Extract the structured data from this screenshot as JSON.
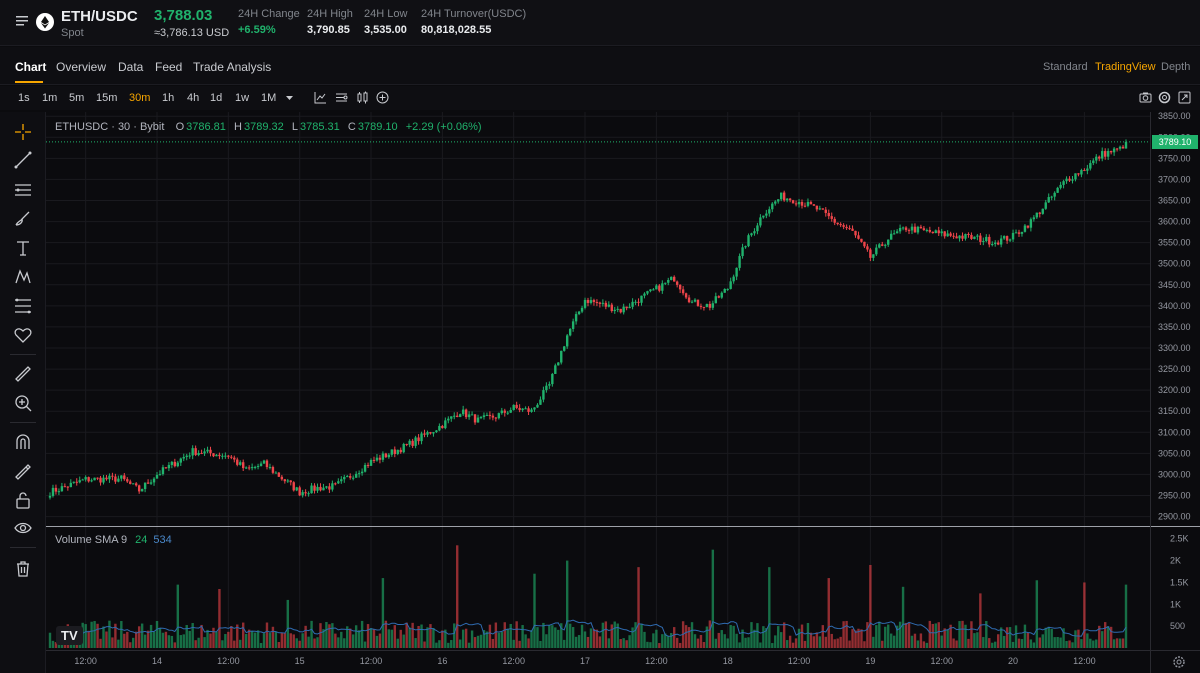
{
  "header": {
    "pair": "ETH/USDC",
    "market_type": "Spot",
    "last_price": "3,788.03",
    "last_price_usd": "≈3,786.13 USD",
    "stats": [
      {
        "label": "24H Change",
        "value": "+6.59%",
        "up": true
      },
      {
        "label": "24H High",
        "value": "3,790.85",
        "up": false
      },
      {
        "label": "24H Low",
        "value": "3,535.00",
        "up": false
      },
      {
        "label": "24H Turnover(USDC)",
        "value": "80,818,028.55",
        "up": false
      }
    ]
  },
  "tabs": [
    "Chart",
    "Overview",
    "Data",
    "Feed",
    "Trade Analysis"
  ],
  "active_tab": "Chart",
  "views": [
    "Standard",
    "TradingView",
    "Depth"
  ],
  "active_view": "TradingView",
  "timeframes": [
    "1s",
    "1m",
    "5m",
    "15m",
    "30m",
    "1h",
    "4h",
    "1d",
    "1w",
    "1M"
  ],
  "active_timeframe": "30m",
  "legend": {
    "symbol": "ETHUSDC · 30 · Bybit",
    "open_label": "O",
    "open": "3786.81",
    "high_label": "H",
    "high": "3789.32",
    "low_label": "L",
    "low": "3785.31",
    "close_label": "C",
    "close": "3789.10",
    "change": "+2.29 (+0.06%)"
  },
  "volume_legend": {
    "label": "Volume SMA 9",
    "value1": "24",
    "value2": "534"
  },
  "logo_text": "TV",
  "colors": {
    "up": "#20b26c",
    "down": "#ef454a",
    "accent": "#f7a600",
    "sma": "#2f6bb0"
  },
  "chart_data": {
    "type": "candlestick",
    "symbol": "ETHUSDC",
    "interval": "30",
    "price_axis": {
      "ylim": [
        2880,
        3860
      ],
      "ticks": [
        "3850.00",
        "3800.00",
        "3750.00",
        "3700.00",
        "3650.00",
        "3600.00",
        "3550.00",
        "3500.00",
        "3450.00",
        "3400.00",
        "3350.00",
        "3300.00",
        "3250.00",
        "3200.00",
        "3150.00",
        "3100.00",
        "3050.00",
        "3000.00",
        "2950.00",
        "2900.00"
      ],
      "tick_values": [
        3850,
        3800,
        3750,
        3700,
        3650,
        3600,
        3550,
        3500,
        3450,
        3400,
        3350,
        3300,
        3250,
        3200,
        3150,
        3100,
        3050,
        3000,
        2950,
        2900
      ],
      "last_price_label": "3789.10",
      "last_price": 3789.1
    },
    "volume_axis": {
      "ylim": [
        0,
        2700
      ],
      "ticks": [
        "2.5K",
        "2K",
        "1.5K",
        "1K",
        "500"
      ],
      "tick_values": [
        2500,
        2000,
        1500,
        1000,
        500
      ]
    },
    "x_axis": {
      "ticks": [
        "12:00",
        "14",
        "12:00",
        "15",
        "12:00",
        "16",
        "12:00",
        "17",
        "12:00",
        "18",
        "12:00",
        "19",
        "12:00",
        "20",
        "12:00"
      ],
      "tick_index": [
        12,
        36,
        60,
        84,
        108,
        132,
        156,
        180,
        204,
        228,
        252,
        276,
        300,
        324,
        348
      ]
    },
    "close_anchors": [
      [
        0,
        2958
      ],
      [
        12,
        2988
      ],
      [
        24,
        2990
      ],
      [
        30,
        2962
      ],
      [
        36,
        3000
      ],
      [
        48,
        3055
      ],
      [
        60,
        3045
      ],
      [
        66,
        3010
      ],
      [
        72,
        3025
      ],
      [
        84,
        2958
      ],
      [
        90,
        2968
      ],
      [
        96,
        2972
      ],
      [
        108,
        3030
      ],
      [
        120,
        3068
      ],
      [
        132,
        3118
      ],
      [
        138,
        3150
      ],
      [
        144,
        3128
      ],
      [
        150,
        3138
      ],
      [
        156,
        3158
      ],
      [
        162,
        3150
      ],
      [
        168,
        3212
      ],
      [
        174,
        3330
      ],
      [
        180,
        3415
      ],
      [
        192,
        3390
      ],
      [
        204,
        3440
      ],
      [
        210,
        3466
      ],
      [
        216,
        3408
      ],
      [
        222,
        3400
      ],
      [
        228,
        3442
      ],
      [
        234,
        3548
      ],
      [
        240,
        3620
      ],
      [
        246,
        3660
      ],
      [
        252,
        3648
      ],
      [
        258,
        3630
      ],
      [
        264,
        3600
      ],
      [
        270,
        3575
      ],
      [
        276,
        3515
      ],
      [
        282,
        3560
      ],
      [
        288,
        3585
      ],
      [
        300,
        3570
      ],
      [
        312,
        3560
      ],
      [
        318,
        3552
      ],
      [
        324,
        3565
      ],
      [
        330,
        3600
      ],
      [
        336,
        3650
      ],
      [
        342,
        3700
      ],
      [
        348,
        3725
      ],
      [
        354,
        3760
      ],
      [
        360,
        3772
      ],
      [
        362,
        3789
      ]
    ],
    "candle_count": 363,
    "volume_profile": {
      "typical": 450,
      "spikes": [
        [
          43,
          1450
        ],
        [
          57,
          1350
        ],
        [
          80,
          1100
        ],
        [
          112,
          1600
        ],
        [
          137,
          2350
        ],
        [
          163,
          1700
        ],
        [
          174,
          2000
        ],
        [
          198,
          1850
        ],
        [
          223,
          2250
        ],
        [
          242,
          1850
        ],
        [
          262,
          1600
        ],
        [
          276,
          1900
        ],
        [
          287,
          1400
        ],
        [
          313,
          1250
        ],
        [
          332,
          1550
        ],
        [
          348,
          1500
        ],
        [
          362,
          1450
        ]
      ]
    },
    "sma_period": 9
  }
}
